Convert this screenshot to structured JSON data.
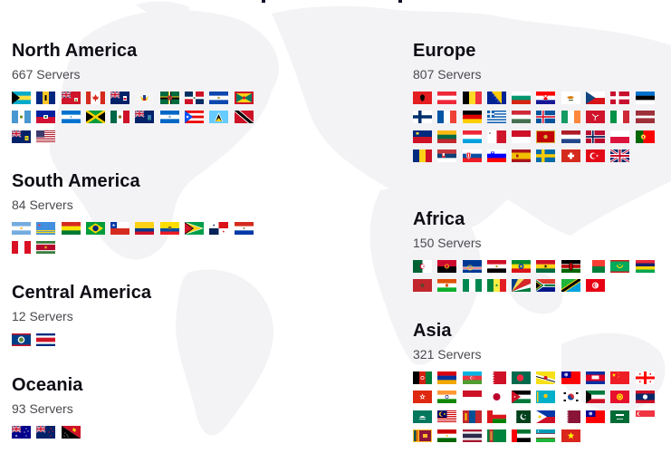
{
  "regions": [
    {
      "id": "north-america",
      "title": "North America",
      "count": "667 Servers",
      "flags": [
        {
          "country": "Bahamas",
          "code": "bs"
        },
        {
          "country": "Barbados",
          "code": "bb"
        },
        {
          "country": "Bermuda",
          "code": "bm"
        },
        {
          "country": "Canada",
          "code": "ca"
        },
        {
          "country": "Cayman Islands",
          "code": "ky"
        },
        {
          "country": "US Virgin Islands",
          "code": "vi"
        },
        {
          "country": "Dominica",
          "code": "dm"
        },
        {
          "country": "Dominican Republic",
          "code": "do"
        },
        {
          "country": "El Salvador",
          "code": "sv"
        },
        {
          "country": "Grenada",
          "code": "gd"
        },
        {
          "country": "Guatemala",
          "code": "gt"
        },
        {
          "country": "Haiti",
          "code": "ht"
        },
        {
          "country": "Honduras",
          "code": "hn"
        },
        {
          "country": "Jamaica",
          "code": "jm"
        },
        {
          "country": "Mexico",
          "code": "mx"
        },
        {
          "country": "Montserrat",
          "code": "ms"
        },
        {
          "country": "Nicaragua",
          "code": "ni"
        },
        {
          "country": "Puerto Rico",
          "code": "pr"
        },
        {
          "country": "Saint Lucia",
          "code": "lc"
        },
        {
          "country": "Trinidad and Tobago",
          "code": "tt"
        },
        {
          "country": "Turks and Caicos Islands",
          "code": "tc"
        },
        {
          "country": "United States",
          "code": "us"
        }
      ]
    },
    {
      "id": "south-america",
      "title": "South America",
      "count": "84 Servers",
      "flags": [
        {
          "country": "Argentina",
          "code": "ar"
        },
        {
          "country": "Aruba",
          "code": "aw"
        },
        {
          "country": "Bolivia",
          "code": "bo"
        },
        {
          "country": "Brazil",
          "code": "br"
        },
        {
          "country": "Chile",
          "code": "cl"
        },
        {
          "country": "Colombia",
          "code": "co"
        },
        {
          "country": "Ecuador",
          "code": "ec"
        },
        {
          "country": "Guyana",
          "code": "gy"
        },
        {
          "country": "Panama",
          "code": "pa"
        },
        {
          "country": "Paraguay",
          "code": "py"
        },
        {
          "country": "Peru",
          "code": "pe"
        },
        {
          "country": "Suriname",
          "code": "sr"
        }
      ]
    },
    {
      "id": "central-america",
      "title": "Central America",
      "count": "12 Servers",
      "flags": [
        {
          "country": "Belize",
          "code": "bz"
        },
        {
          "country": "Costa Rica",
          "code": "cr"
        }
      ]
    },
    {
      "id": "oceania",
      "title": "Oceania",
      "count": "93 Servers",
      "flags": [
        {
          "country": "Australia",
          "code": "au"
        },
        {
          "country": "New Zealand",
          "code": "nz"
        },
        {
          "country": "Papua New Guinea",
          "code": "pg"
        }
      ]
    },
    {
      "id": "europe",
      "title": "Europe",
      "count": "807 Servers",
      "flags": [
        {
          "country": "Albania",
          "code": "al"
        },
        {
          "country": "Austria",
          "code": "at"
        },
        {
          "country": "Belgium",
          "code": "be"
        },
        {
          "country": "Bosnia and Herzegovina",
          "code": "ba"
        },
        {
          "country": "Bulgaria",
          "code": "bg"
        },
        {
          "country": "Croatia",
          "code": "hr"
        },
        {
          "country": "Cyprus",
          "code": "cy"
        },
        {
          "country": "Czech Republic",
          "code": "cz"
        },
        {
          "country": "Denmark",
          "code": "dk"
        },
        {
          "country": "Estonia",
          "code": "ee"
        },
        {
          "country": "Finland",
          "code": "fi"
        },
        {
          "country": "France",
          "code": "fr"
        },
        {
          "country": "Germany",
          "code": "de"
        },
        {
          "country": "Greece",
          "code": "gr"
        },
        {
          "country": "Hungary",
          "code": "hu"
        },
        {
          "country": "Iceland",
          "code": "is"
        },
        {
          "country": "Ireland",
          "code": "ie"
        },
        {
          "country": "Isle of Man",
          "code": "im"
        },
        {
          "country": "Italy",
          "code": "it"
        },
        {
          "country": "Latvia",
          "code": "lv"
        },
        {
          "country": "Liechtenstein",
          "code": "li"
        },
        {
          "country": "Lithuania",
          "code": "lt"
        },
        {
          "country": "Luxembourg",
          "code": "lu"
        },
        {
          "country": "Malta",
          "code": "mt"
        },
        {
          "country": "Monaco",
          "code": "mc"
        },
        {
          "country": "Montenegro",
          "code": "me"
        },
        {
          "country": "Netherlands",
          "code": "nl"
        },
        {
          "country": "Norway",
          "code": "no"
        },
        {
          "country": "Poland",
          "code": "pl"
        },
        {
          "country": "Portugal",
          "code": "pt"
        },
        {
          "country": "Romania",
          "code": "ro"
        },
        {
          "country": "Serbia",
          "code": "rs"
        },
        {
          "country": "Slovakia",
          "code": "sk"
        },
        {
          "country": "Slovenia",
          "code": "si"
        },
        {
          "country": "Spain",
          "code": "es"
        },
        {
          "country": "Sweden",
          "code": "se"
        },
        {
          "country": "Switzerland",
          "code": "ch"
        },
        {
          "country": "Turkey",
          "code": "tr"
        },
        {
          "country": "United Kingdom",
          "code": "gb"
        }
      ]
    },
    {
      "id": "africa",
      "title": "Africa",
      "count": "150 Servers",
      "flags": [
        {
          "country": "Algeria",
          "code": "dz"
        },
        {
          "country": "Angola",
          "code": "ao"
        },
        {
          "country": "Cape Verde",
          "code": "cv"
        },
        {
          "country": "Egypt",
          "code": "eg"
        },
        {
          "country": "Ethiopia",
          "code": "et"
        },
        {
          "country": "Ghana",
          "code": "gh"
        },
        {
          "country": "Kenya",
          "code": "ke"
        },
        {
          "country": "Madagascar",
          "code": "mg"
        },
        {
          "country": "Mauritania",
          "code": "mr"
        },
        {
          "country": "Mauritius",
          "code": "mu"
        },
        {
          "country": "Morocco",
          "code": "ma"
        },
        {
          "country": "Niger",
          "code": "ne"
        },
        {
          "country": "Nigeria",
          "code": "ng"
        },
        {
          "country": "Senegal",
          "code": "sn"
        },
        {
          "country": "Seychelles",
          "code": "sc"
        },
        {
          "country": "South Africa",
          "code": "za"
        },
        {
          "country": "Tanzania",
          "code": "tz"
        },
        {
          "country": "Tunisia",
          "code": "tn"
        }
      ]
    },
    {
      "id": "asia",
      "title": "Asia",
      "count": "321 Servers",
      "flags": [
        {
          "country": "Afghanistan",
          "code": "af"
        },
        {
          "country": "Armenia",
          "code": "am"
        },
        {
          "country": "Azerbaijan",
          "code": "az"
        },
        {
          "country": "Bahrain",
          "code": "bh"
        },
        {
          "country": "Bangladesh",
          "code": "bd"
        },
        {
          "country": "Brunei",
          "code": "bn"
        },
        {
          "country": "Taiwan",
          "code": "tw"
        },
        {
          "country": "Cambodia",
          "code": "kh"
        },
        {
          "country": "China",
          "code": "cn"
        },
        {
          "country": "Georgia",
          "code": "ge"
        },
        {
          "country": "Hong Kong",
          "code": "hk"
        },
        {
          "country": "India",
          "code": "in"
        },
        {
          "country": "Indonesia",
          "code": "id"
        },
        {
          "country": "Japan",
          "code": "jp"
        },
        {
          "country": "Jordan",
          "code": "jo"
        },
        {
          "country": "Kazakhstan",
          "code": "kz"
        },
        {
          "country": "South Korea",
          "code": "kr"
        },
        {
          "country": "Kuwait",
          "code": "kw"
        },
        {
          "country": "Kyrgyzstan",
          "code": "kg"
        },
        {
          "country": "Laos",
          "code": "la"
        },
        {
          "country": "Macau",
          "code": "mo"
        },
        {
          "country": "Malaysia",
          "code": "my"
        },
        {
          "country": "Mongolia",
          "code": "mn"
        },
        {
          "country": "Oman",
          "code": "om"
        },
        {
          "country": "Pakistan",
          "code": "pk"
        },
        {
          "country": "Philippines",
          "code": "ph"
        },
        {
          "country": "Qatar",
          "code": "qa"
        },
        {
          "country": "Taiwan",
          "code": "tw"
        },
        {
          "country": "Saudi Arabia",
          "code": "sa"
        },
        {
          "country": "Singapore",
          "code": "sg"
        },
        {
          "country": "Sri Lanka",
          "code": "lk"
        },
        {
          "country": "Tajikistan",
          "code": "tj"
        },
        {
          "country": "Thailand",
          "code": "th"
        },
        {
          "country": "Turkmenistan",
          "code": "tm"
        },
        {
          "country": "United Arab Emirates",
          "code": "ae"
        },
        {
          "country": "Uzbekistan",
          "code": "uz"
        },
        {
          "country": "Vietnam",
          "code": "vn"
        }
      ]
    }
  ]
}
